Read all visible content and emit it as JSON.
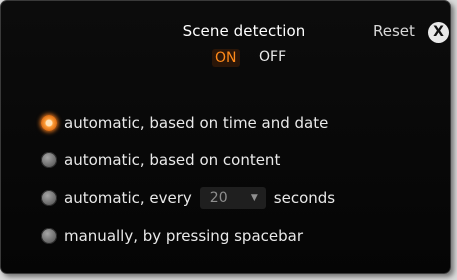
{
  "header": {
    "title": "Scene detection",
    "reset_label": "Reset",
    "close_glyph": "X"
  },
  "toggle": {
    "on_label": "ON",
    "off_label": "OFF",
    "selected": "ON"
  },
  "options": [
    {
      "label": "automatic, based on time and date",
      "selected": true
    },
    {
      "label": "automatic, based on content",
      "selected": false
    },
    {
      "label_before": "automatic, every",
      "dropdown_value": "20",
      "label_after": "seconds",
      "selected": false
    },
    {
      "label": "manually, by pressing spacebar",
      "selected": false
    }
  ],
  "colors": {
    "accent": "#ff8a1a",
    "background": "#080808",
    "text": "#e9e9e9"
  },
  "icons": {
    "close": "close-icon",
    "dropdown": "chevron-down-icon"
  }
}
